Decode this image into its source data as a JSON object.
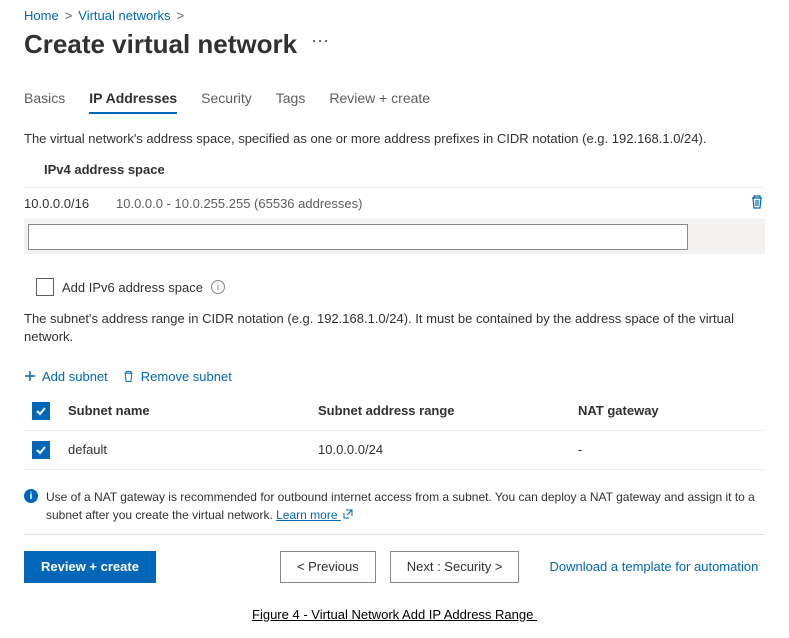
{
  "breadcrumb": {
    "home": "Home",
    "section": "Virtual networks"
  },
  "title": "Create virtual network",
  "tabs": {
    "basics": "Basics",
    "ip": "IP Addresses",
    "security": "Security",
    "tags": "Tags",
    "review": "Review + create"
  },
  "intro_text": "The virtual network's address space, specified as one or more address prefixes in CIDR notation (e.g. 192.168.1.0/24).",
  "ipv4": {
    "header": "IPv4 address space",
    "cidr": "10.0.0.0/16",
    "range": "10.0.0.0 - 10.0.255.255 (65536 addresses)",
    "new_placeholder": ""
  },
  "ipv6": {
    "label": "Add IPv6 address space"
  },
  "subnet": {
    "text": "The subnet's address range in CIDR notation (e.g. 192.168.1.0/24). It must be contained by the address space of the virtual network.",
    "add": "Add subnet",
    "remove": "Remove subnet",
    "cols": {
      "name": "Subnet name",
      "range": "Subnet address range",
      "nat": "NAT gateway"
    },
    "rows": [
      {
        "name": "default",
        "range": "10.0.0.0/24",
        "nat": "-"
      }
    ]
  },
  "banner": {
    "text": "Use of a NAT gateway is recommended for outbound internet access from a subnet. You can deploy a NAT gateway and assign it to a subnet after you create the virtual network. ",
    "learn": "Learn more"
  },
  "footer": {
    "review": "Review + create",
    "prev": "< Previous",
    "next": "Next : Security >",
    "tmpl": "Download a template for automation"
  },
  "caption": "Figure 4 - Virtual Network Add IP Address Range"
}
